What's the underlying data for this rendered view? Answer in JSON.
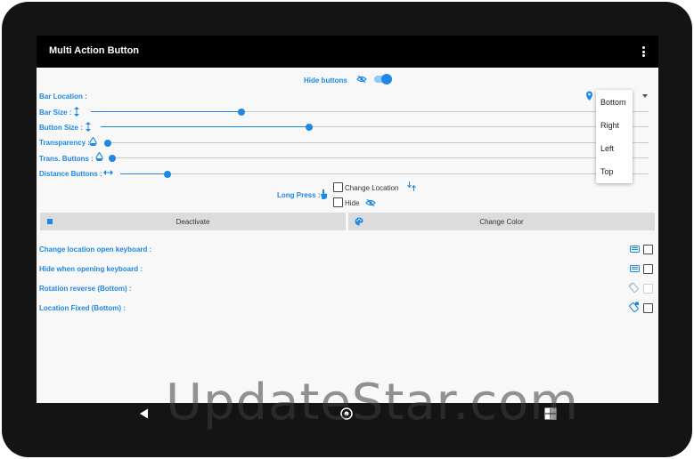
{
  "app": {
    "title": "Multi Action Button"
  },
  "hide_buttons": {
    "label": "Hide buttons",
    "enabled": true
  },
  "settings": {
    "bar_location": "Bar Location :",
    "bar_size": "Bar Size :",
    "button_size": "Button Size :",
    "transparency": "Transparency :",
    "trans_buttons": "Trans. Buttons :",
    "distance_buttons": "Distance Buttons :"
  },
  "sliders": {
    "bar_size": 0.27,
    "button_size": 0.38,
    "transparency": 0.0,
    "trans_buttons": 0.0,
    "distance_buttons": 0.09
  },
  "long_press": {
    "label": "Long Press :",
    "change_location": "Change Location",
    "hide": "Hide"
  },
  "buttons": {
    "deactivate": "Deactivate",
    "change_color": "Change Color"
  },
  "options": {
    "change_location_keyboard": "Change location open keyboard :",
    "hide_keyboard": "Hide when opening keyboard :",
    "rotation_reverse": "Rotation reverse (Bottom) :",
    "location_fixed": "Location Fixed (Bottom) :"
  },
  "dropdown": {
    "options": [
      "Bottom",
      "Right",
      "Left",
      "Top"
    ]
  },
  "watermark": "UpdateStar.com",
  "colors": {
    "accent": "#1e88e5",
    "appbar": "#000000",
    "device": "#141414"
  }
}
